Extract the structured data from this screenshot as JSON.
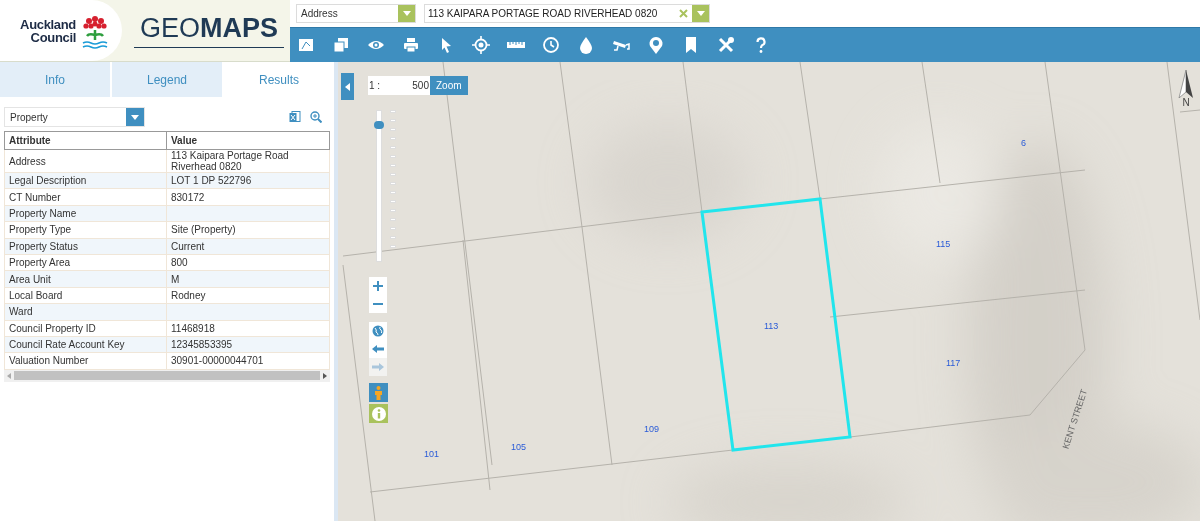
{
  "logo": {
    "org": "Auckland Council",
    "product": "GEO**MAPS**"
  },
  "search": {
    "type": "Address",
    "value": "113 KAIPARA PORTAGE ROAD RIVERHEAD 0820"
  },
  "tabs": [
    {
      "label": "Info",
      "selected": false
    },
    {
      "label": "Legend",
      "selected": false
    },
    {
      "label": "Results",
      "selected": true
    }
  ],
  "layer_select": {
    "value": "Property"
  },
  "table": {
    "columns": [
      "Attribute",
      "Value"
    ],
    "rows": [
      [
        "Address",
        "113 Kaipara Portage Road Riverhead 0820"
      ],
      [
        "Legal Description",
        "LOT 1 DP 522796"
      ],
      [
        "CT Number",
        "830172"
      ],
      [
        "Property Name",
        ""
      ],
      [
        "Property Type",
        "Site (Property)"
      ],
      [
        "Property Status",
        "Current"
      ],
      [
        "Property Area",
        "800"
      ],
      [
        "Area Unit",
        "M"
      ],
      [
        "Local Board",
        "Rodney"
      ],
      [
        "Ward",
        ""
      ],
      [
        "Council Property ID",
        "11468918"
      ],
      [
        "Council Rate Account Key",
        "12345853395"
      ],
      [
        "Valuation Number",
        "30901-00000044701"
      ]
    ]
  },
  "map": {
    "scale_prefix": "1 :",
    "scale_value": "500",
    "zoom_button": "Zoom",
    "zoom_slider": {
      "level": 0.93
    },
    "nav": [
      {
        "kind": "globe",
        "disabled": false
      },
      {
        "kind": "back",
        "disabled": false
      },
      {
        "kind": "forward",
        "disabled": true
      }
    ],
    "labels": [
      "6",
      "115",
      "113",
      "117",
      "109",
      "105",
      "101"
    ],
    "street": "KENT STREET",
    "north": "N"
  }
}
